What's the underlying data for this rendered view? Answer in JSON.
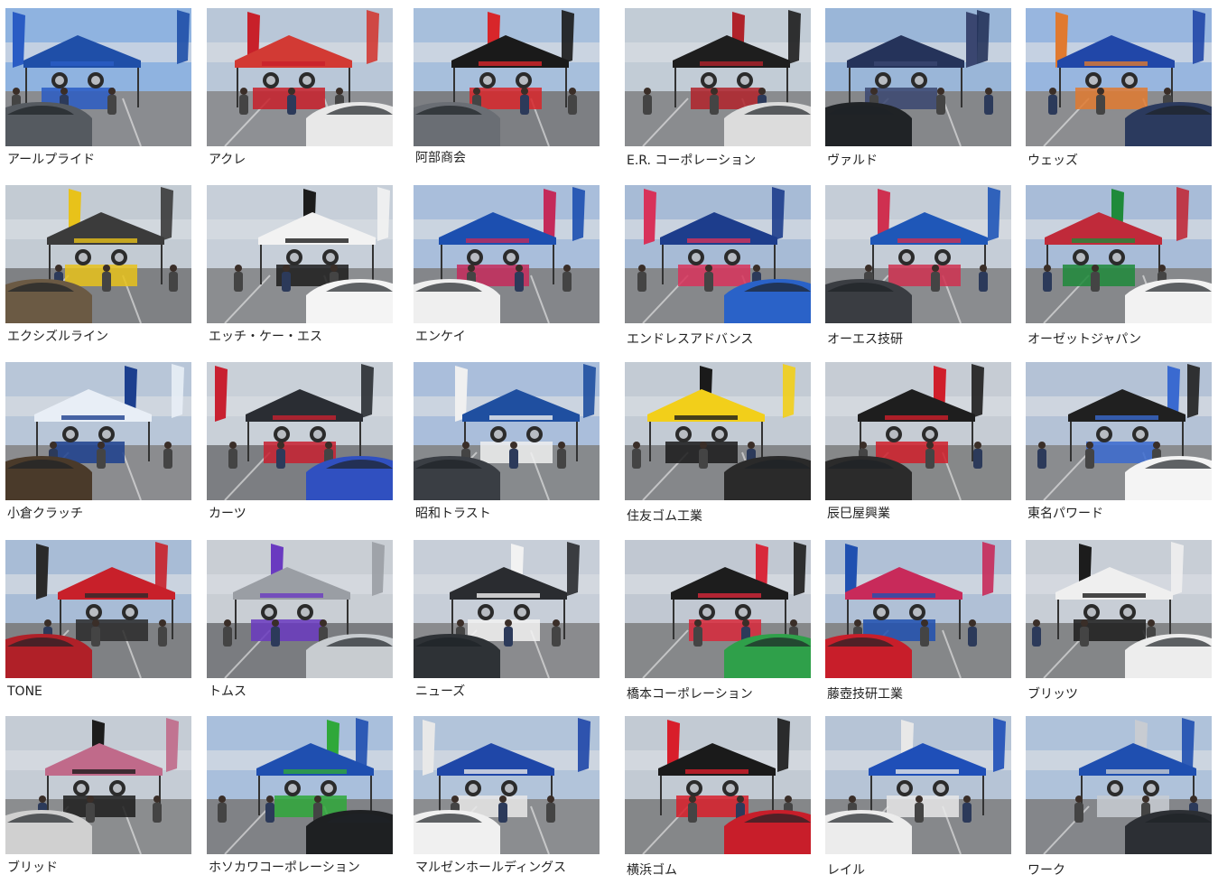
{
  "booths": [
    {
      "name": "アールプライド",
      "sky": "#8fb3e0",
      "tent": "#1f4fa8",
      "ground": "#8a8c90",
      "accent": "#2a5cc4",
      "car": "#555a60"
    },
    {
      "name": "アクレ",
      "sky": "#b9c7d8",
      "tent": "#d23a34",
      "ground": "#8e9094",
      "accent": "#c8202a",
      "car": "#e8e8e8"
    },
    {
      "name": "阿部商会",
      "sky": "#a7bfdc",
      "tent": "#1a1a1a",
      "ground": "#7d7f83",
      "accent": "#d8262a",
      "car": "#6a6e74"
    },
    {
      "name": "E.R. コーポレーション",
      "sky": "#c2ccd6",
      "tent": "#1e1e1e",
      "ground": "#8a8c8f",
      "accent": "#b0222a",
      "car": "#dcdcdc"
    },
    {
      "name": "ヴァルド",
      "sky": "#9ab6d8",
      "tent": "#25335a",
      "ground": "#85878a",
      "accent": "#3a4670",
      "car": "#202326"
    },
    {
      "name": "ウェッズ",
      "sky": "#98b6df",
      "tent": "#2147a8",
      "ground": "#8c8d90",
      "accent": "#e07a30",
      "car": "#2b3a5e"
    },
    {
      "name": "エクシズルライン",
      "sky": "#c3cbd3",
      "tent": "#3b3b3b",
      "ground": "#7f8184",
      "accent": "#e8c21a",
      "car": "#6b5a44"
    },
    {
      "name": "エッチ・ケー・エス",
      "sky": "#c7cfd9",
      "tent": "#f2f2f2",
      "ground": "#8b8d90",
      "accent": "#1c1c1c",
      "car": "#f4f4f4"
    },
    {
      "name": "エンケイ",
      "sky": "#a9bedb",
      "tent": "#1c4fb0",
      "ground": "#84868a",
      "accent": "#c42a5a",
      "car": "#efefef"
    },
    {
      "name": "エンドレスアドバンス",
      "sky": "#a7bbd6",
      "tent": "#1d3d8c",
      "ground": "#86888b",
      "accent": "#d8325a",
      "car": "#2a62c8"
    },
    {
      "name": "オーエス技研",
      "sky": "#c5cdd7",
      "tent": "#1f57b8",
      "ground": "#8a8c8f",
      "accent": "#cf3050",
      "car": "#3a3d42"
    },
    {
      "name": "オーゼットジャパン",
      "sky": "#a8bcd8",
      "tent": "#c02a3a",
      "ground": "#86888b",
      "accent": "#1f8a3a",
      "car": "#f2f2f2"
    },
    {
      "name": "小倉クラッチ",
      "sky": "#b8c6d8",
      "tent": "#e8eef6",
      "ground": "#8b8c8f",
      "accent": "#1c3f8e",
      "car": "#4a3a2a"
    },
    {
      "name": "カーツ",
      "sky": "#c9d0d8",
      "tent": "#2a2d33",
      "ground": "#7c7e82",
      "accent": "#c82030",
      "car": "#3050c0"
    },
    {
      "name": "昭和トラスト",
      "sky": "#aabedb",
      "tent": "#1f4fa0",
      "ground": "#878a8d",
      "accent": "#f0f0f0",
      "car": "#3a3e44"
    },
    {
      "name": "住友ゴム工業",
      "sky": "#c3cbd4",
      "tent": "#f2cf1a",
      "ground": "#85878a",
      "accent": "#1a1a1a",
      "car": "#2a2a2a"
    },
    {
      "name": "辰巳屋興業",
      "sky": "#c6ccd4",
      "tent": "#1e1e1e",
      "ground": "#868889",
      "accent": "#d01e2a",
      "car": "#2b2b2b"
    },
    {
      "name": "東名パワード",
      "sky": "#b4c2d6",
      "tent": "#202020",
      "ground": "#8a8c8f",
      "accent": "#3a6ad0",
      "car": "#f4f4f4"
    },
    {
      "name": "TONE",
      "sky": "#a8bcd6",
      "tent": "#c8202a",
      "ground": "#7f8184",
      "accent": "#2a2a2a",
      "car": "#b02028"
    },
    {
      "name": "トムス",
      "sky": "#c9ced4",
      "tent": "#9a9ea4",
      "ground": "#7a7c80",
      "accent": "#6a3ac0",
      "car": "#c8ccd0"
    },
    {
      "name": "ニューズ",
      "sky": "#c7ced8",
      "tent": "#2a2c30",
      "ground": "#8a8b8e",
      "accent": "#f2f2f2",
      "car": "#2e3236"
    },
    {
      "name": "橋本コーポレーション",
      "sky": "#c1c8d2",
      "tent": "#1d1d1d",
      "ground": "#86888a",
      "accent": "#d8283a",
      "car": "#2fa04a"
    },
    {
      "name": "藤壺技研工業",
      "sky": "#b0c0d6",
      "tent": "#c82a5a",
      "ground": "#858789",
      "accent": "#2050b0",
      "car": "#c81e2a"
    },
    {
      "name": "ブリッツ",
      "sky": "#c8ced6",
      "tent": "#efefef",
      "ground": "#848688",
      "accent": "#1c1c1c",
      "car": "#ededed"
    },
    {
      "name": "ブリッド",
      "sky": "#c5ccd5",
      "tent": "#c06a8a",
      "ground": "#8b8d8f",
      "accent": "#1c1c1c",
      "car": "#d0d0d0"
    },
    {
      "name": "ホソカワコーポレーション",
      "sky": "#a9bfdc",
      "tent": "#1f4fb0",
      "ground": "#808286",
      "accent": "#2fa83a",
      "car": "#1e2022"
    },
    {
      "name": "マルゼンホールディングス",
      "sky": "#b2c4da",
      "tent": "#1f47a8",
      "ground": "#8b8d90",
      "accent": "#e8e8e8",
      "car": "#f0f0f0"
    },
    {
      "name": "横浜ゴム",
      "sky": "#c2cad3",
      "tent": "#1a1a1a",
      "ground": "#858789",
      "accent": "#d81e2a",
      "car": "#c81e2a"
    },
    {
      "name": "レイル",
      "sky": "#b6c4d6",
      "tent": "#1f4fb8",
      "ground": "#86888b",
      "accent": "#e8e8e8",
      "car": "#ececec"
    },
    {
      "name": "ワーク",
      "sky": "#afc2da",
      "tent": "#1f4fb0",
      "ground": "#84868a",
      "accent": "#c8ccd2",
      "car": "#2c2f34"
    }
  ]
}
